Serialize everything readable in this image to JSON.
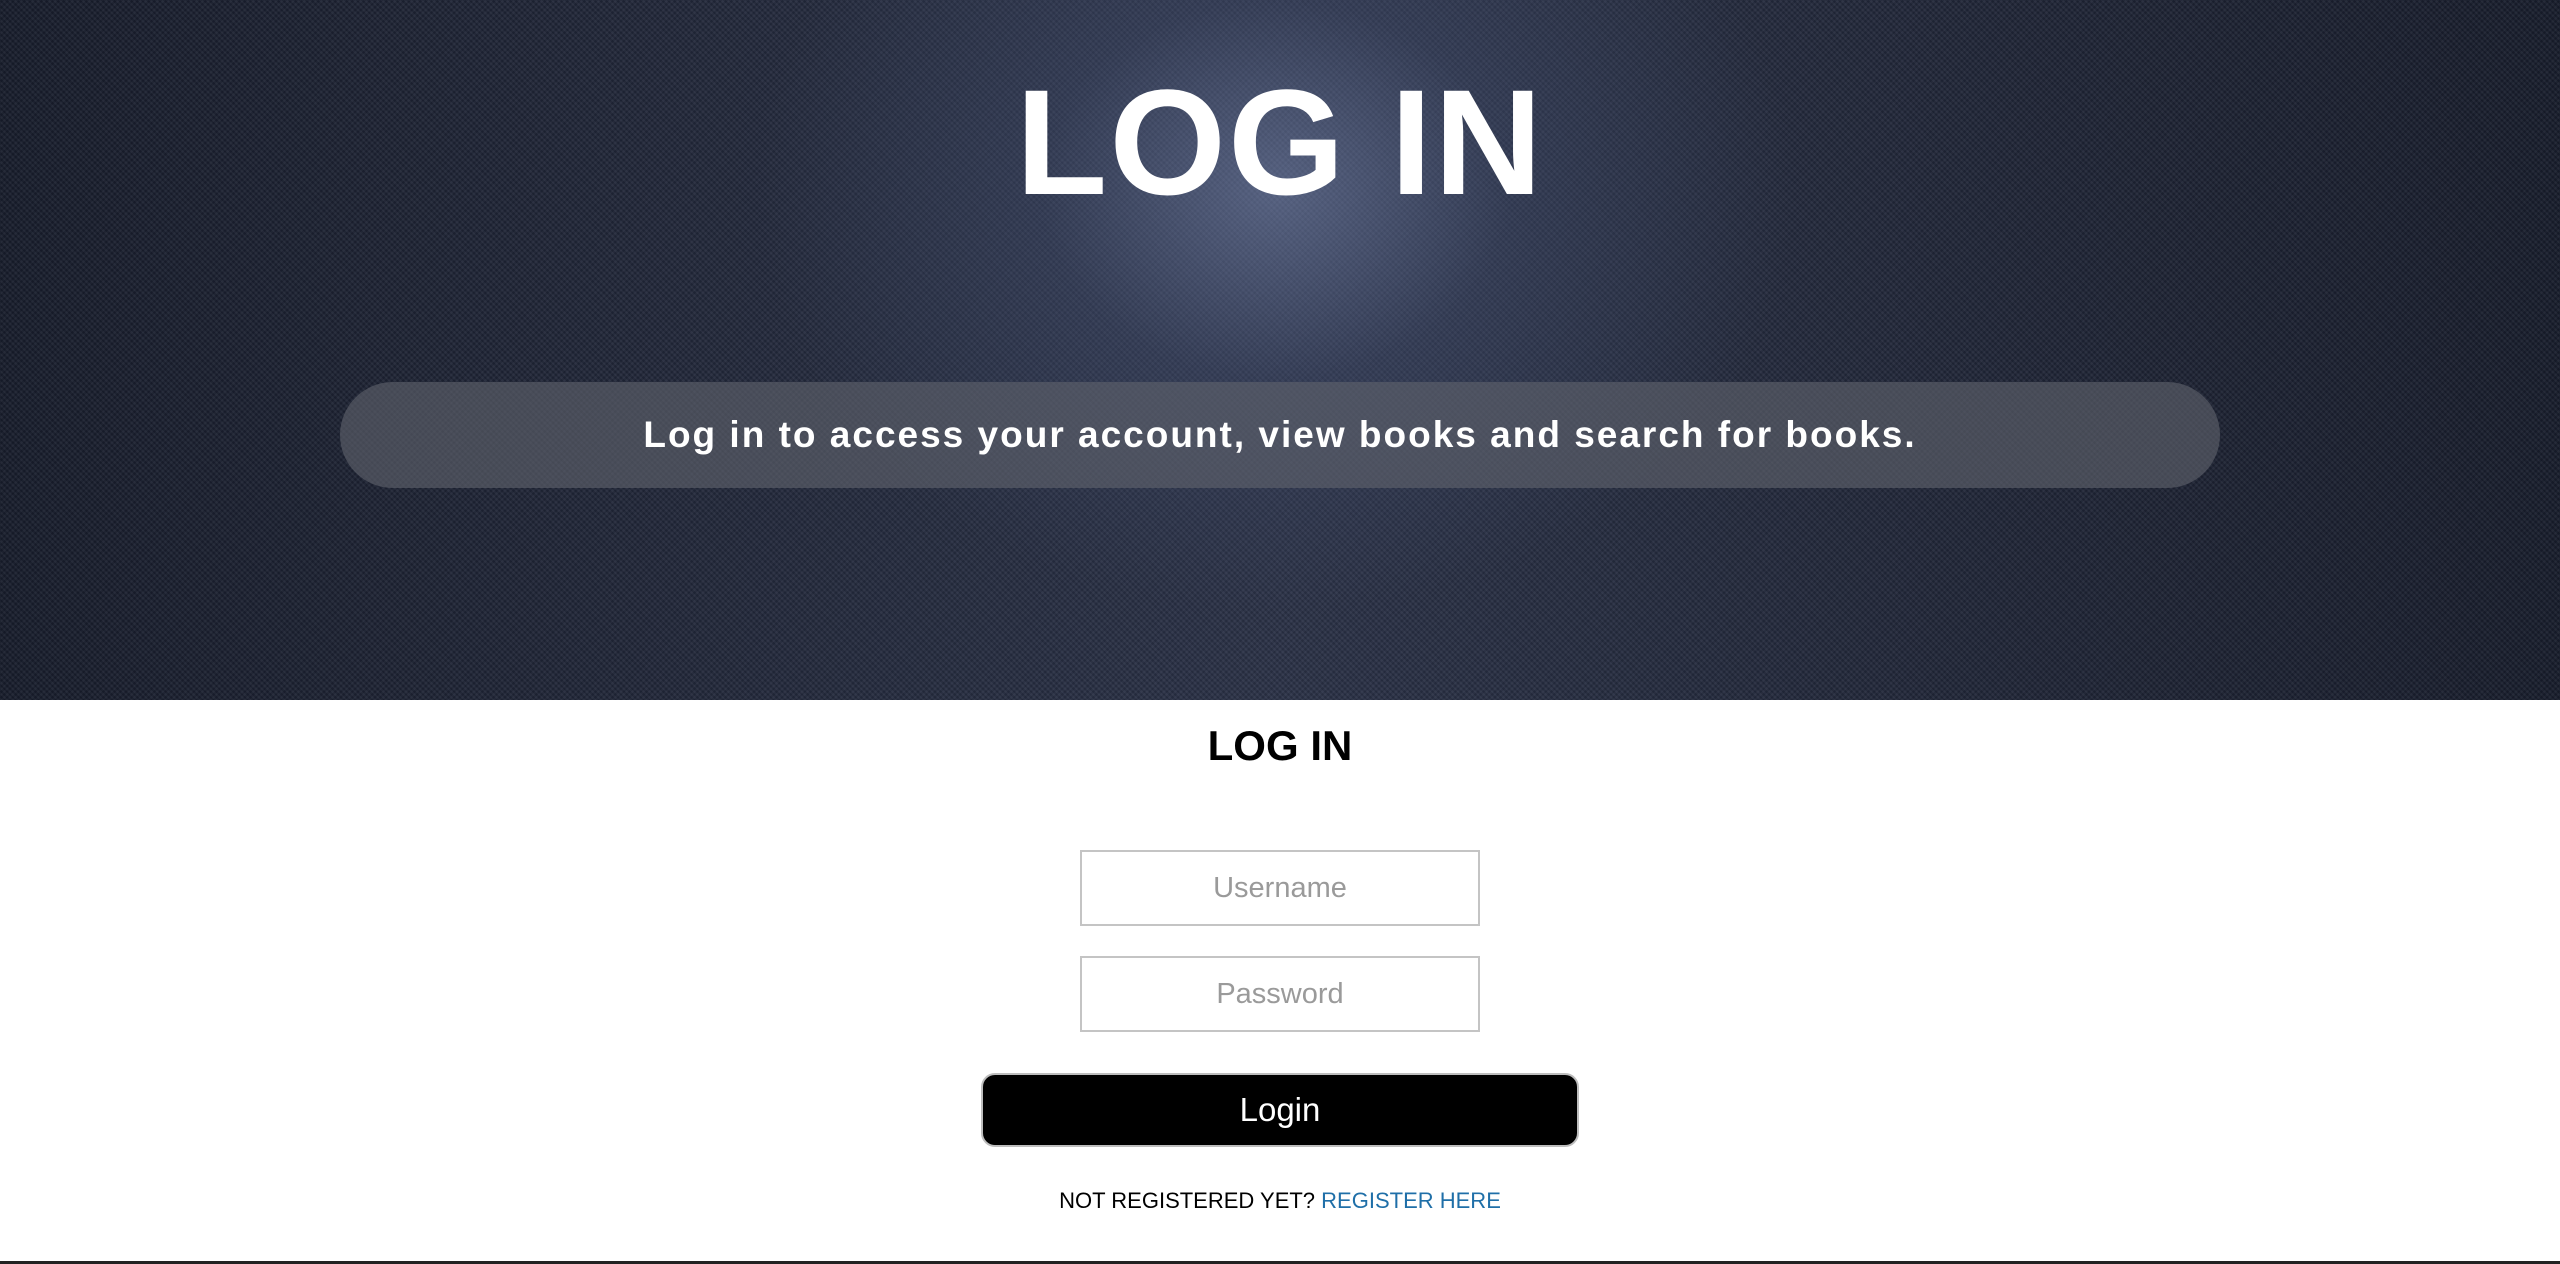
{
  "hero": {
    "title": "LOG IN",
    "subtitle": "Log in to access your account, view books and search for books."
  },
  "form": {
    "title": "LOG IN",
    "username": {
      "value": "",
      "placeholder": "Username"
    },
    "password": {
      "value": "",
      "placeholder": "Password"
    },
    "submit_label": "Login"
  },
  "register": {
    "prompt": "NOT REGISTERED YET?",
    "link_label": "REGISTER HERE"
  },
  "colors": {
    "hero_background": "#1c2233",
    "button_background": "#000000",
    "link": "#1f6fa8"
  }
}
